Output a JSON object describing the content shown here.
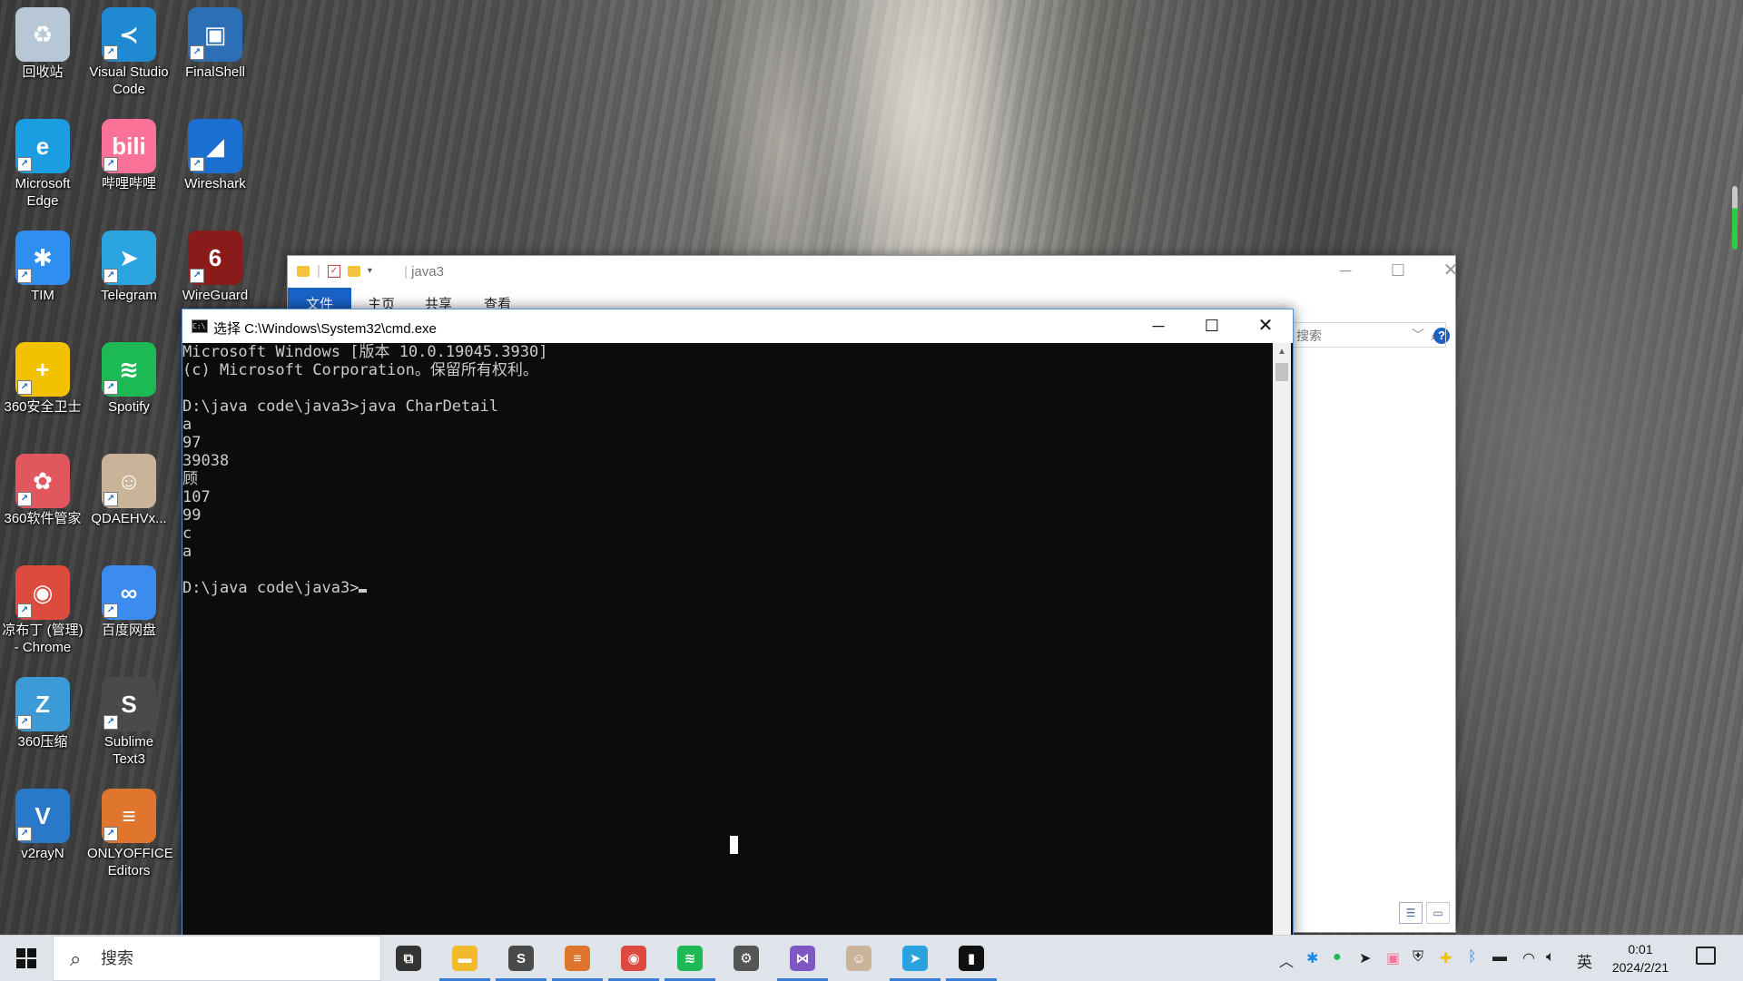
{
  "desktop": {
    "icons": [
      {
        "label": "回收站",
        "glyph": "♻",
        "color": "#b8c7d6"
      },
      {
        "label": "Visual Studio Code",
        "glyph": "≺",
        "color": "#1f8ad2"
      },
      {
        "label": "FinalShell",
        "glyph": "▣",
        "color": "#2c6fb5"
      },
      {
        "label": "Microsoft Edge",
        "glyph": "e",
        "color": "#1b9de2"
      },
      {
        "label": "哔哩哔哩",
        "glyph": "bili",
        "color": "#fb7299"
      },
      {
        "label": "Wireshark",
        "glyph": "◢",
        "color": "#1a6fd0"
      },
      {
        "label": "TIM",
        "glyph": "✱",
        "color": "#2f8ff0"
      },
      {
        "label": "Telegram",
        "glyph": "➤",
        "color": "#2aa3df"
      },
      {
        "label": "WireGuard",
        "glyph": "6",
        "color": "#8b1a1a"
      },
      {
        "label": "360安全卫士",
        "glyph": "+",
        "color": "#f2c200"
      },
      {
        "label": "Spotify",
        "glyph": "≋",
        "color": "#1db954"
      },
      {
        "label": "360软件管家",
        "glyph": "✿",
        "color": "#e2575d"
      },
      {
        "label": "QDAEHVx...",
        "glyph": "☺",
        "color": "#c9b49a"
      },
      {
        "label": "凉布丁 (管理) - Chrome",
        "glyph": "◉",
        "color": "#dd4b3e"
      },
      {
        "label": "百度网盘",
        "glyph": "∞",
        "color": "#3c8cf0"
      },
      {
        "label": "360压缩",
        "glyph": "Z",
        "color": "#3c9ad6"
      },
      {
        "label": "Sublime Text3",
        "glyph": "S",
        "color": "#4a4a4a"
      },
      {
        "label": "v2rayN",
        "glyph": "V",
        "color": "#2a78c8"
      },
      {
        "label": "ONLYOFFICE Editors",
        "glyph": "≡",
        "color": "#e0762e"
      }
    ]
  },
  "explorer": {
    "title": "java3",
    "ribbon_tabs": [
      "文件",
      "主页",
      "共享",
      "查看"
    ],
    "search_placeholder": "搜索",
    "help": "?"
  },
  "cmd": {
    "title": "选择 C:\\Windows\\System32\\cmd.exe",
    "lines": [
      "Microsoft Windows [版本 10.0.19045.3930]",
      "(c) Microsoft Corporation。保留所有权利。",
      "",
      "D:\\java code\\java3>java CharDetail",
      "a",
      "97",
      "39038",
      "顾",
      "107",
      "99",
      "c",
      "a",
      "",
      "D:\\java code\\java3>"
    ]
  },
  "taskbar": {
    "search_placeholder": "搜索",
    "apps": [
      {
        "name": "task-view",
        "glyph": "⧉",
        "color": "#333",
        "active": false
      },
      {
        "name": "file-explorer",
        "glyph": "▬",
        "color": "#f3b92c",
        "active": true
      },
      {
        "name": "sublime-text",
        "glyph": "S",
        "color": "#4a4a4a",
        "active": true
      },
      {
        "name": "onlyoffice",
        "glyph": "≡",
        "color": "#e0762e",
        "active": true
      },
      {
        "name": "chrome",
        "glyph": "◉",
        "color": "#dd4b3e",
        "active": true
      },
      {
        "name": "spotify",
        "glyph": "≋",
        "color": "#1db954",
        "active": true
      },
      {
        "name": "settings",
        "glyph": "⚙",
        "color": "#555",
        "active": false
      },
      {
        "name": "visual-studio",
        "glyph": "⋈",
        "color": "#7e57c2",
        "active": true
      },
      {
        "name": "avatar-app",
        "glyph": "☺",
        "color": "#c9b49a",
        "active": false
      },
      {
        "name": "telegram",
        "glyph": "➤",
        "color": "#2aa3df",
        "active": true
      },
      {
        "name": "cmd",
        "glyph": "▮",
        "color": "#111",
        "active": true
      }
    ],
    "tray": {
      "ime": "英",
      "time": "0:01",
      "date": "2024/2/21"
    }
  }
}
